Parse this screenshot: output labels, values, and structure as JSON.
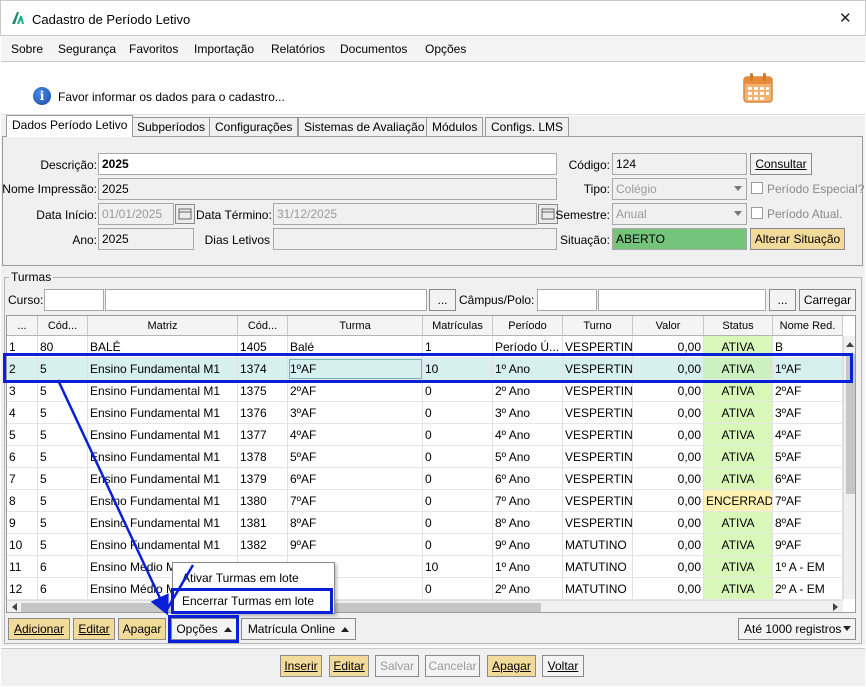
{
  "window": {
    "title": "Cadastro de Período Letivo",
    "close": "✕"
  },
  "menu": [
    "Sobre",
    "Segurança",
    "Favoritos",
    "Importação",
    "Relatórios",
    "Documentos",
    "Opções"
  ],
  "info": {
    "text": "Favor informar os dados para o cadastro..."
  },
  "tabs": [
    "Dados Período Letivo",
    "Subperíodos",
    "Configurações",
    "Sistemas de Avaliação",
    "Módulos",
    "Configs. LMS"
  ],
  "form": {
    "descricao_label": "Descrição:",
    "descricao": "2025",
    "nome_impressao_label": "Nome Impressão:",
    "nome_impressao": "2025",
    "data_inicio_label": "Data Início:",
    "data_inicio": "01/01/2025",
    "data_termino_label": "Data Término:",
    "data_termino": "31/12/2025",
    "ano_label": "Ano:",
    "ano": "2025",
    "dias_letivos_label": "Dias Letivos",
    "codigo_label": "Código:",
    "codigo": "124",
    "consultar": "Consultar",
    "tipo_label": "Tipo:",
    "tipo": "Colégio",
    "periodo_especial": "Período Especial?",
    "semestre_label": "Semestre:",
    "semestre": "Anual",
    "periodo_atual": "Período Atual.",
    "situacao_label": "Situação:",
    "situacao": "ABERTO",
    "alterar_situacao": "Alterar Situação"
  },
  "turmas": {
    "group_label": "Turmas",
    "curso_label": "Curso:",
    "campus_label": "Câmpus/Polo:",
    "dots": "...",
    "carregar": "Carregar",
    "columns": [
      "...",
      "Cód...",
      "Matriz",
      "Cód...",
      "Turma",
      "Matrículas",
      "Período",
      "Turno",
      "Valor",
      "Status",
      "Nome Red."
    ],
    "rows": [
      [
        "1",
        "80",
        "BALÉ",
        "1405",
        "Balé",
        "1",
        "Período Ú...",
        "VESPERTINO",
        "0,00",
        "ATIVA",
        "B"
      ],
      [
        "2",
        "5",
        "Ensino Fundamental M1",
        "1374",
        "1ºAF",
        "10",
        "1º Ano",
        "VESPERTINO",
        "0,00",
        "ATIVA",
        "1ºAF"
      ],
      [
        "3",
        "5",
        "Ensino Fundamental M1",
        "1375",
        "2ºAF",
        "0",
        "2º Ano",
        "VESPERTINO",
        "0,00",
        "ATIVA",
        "2ºAF"
      ],
      [
        "4",
        "5",
        "Ensino Fundamental M1",
        "1376",
        "3ºAF",
        "0",
        "3º Ano",
        "VESPERTINO",
        "0,00",
        "ATIVA",
        "3ºAF"
      ],
      [
        "5",
        "5",
        "Ensino Fundamental M1",
        "1377",
        "4ºAF",
        "0",
        "4º Ano",
        "VESPERTINO",
        "0,00",
        "ATIVA",
        "4ºAF"
      ],
      [
        "6",
        "5",
        "Ensino Fundamental M1",
        "1378",
        "5ºAF",
        "0",
        "5º Ano",
        "VESPERTINO",
        "0,00",
        "ATIVA",
        "5ºAF"
      ],
      [
        "7",
        "5",
        "Ensino Fundamental M1",
        "1379",
        "6ºAF",
        "0",
        "6º Ano",
        "VESPERTINO",
        "0,00",
        "ATIVA",
        "6ºAF"
      ],
      [
        "8",
        "5",
        "Ensino Fundamental M1",
        "1380",
        "7ºAF",
        "0",
        "7º Ano",
        "VESPERTINO",
        "0,00",
        "ENCERRADA",
        "7ºAF"
      ],
      [
        "9",
        "5",
        "Ensino Fundamental M1",
        "1381",
        "8ºAF",
        "0",
        "8º Ano",
        "VESPERTINO",
        "0,00",
        "ATIVA",
        "8ºAF"
      ],
      [
        "10",
        "5",
        "Ensino Fundamental M1",
        "1382",
        "9ºAF",
        "0",
        "9º Ano",
        "MATUTINO",
        "0,00",
        "ATIVA",
        "9ºAF"
      ],
      [
        "11",
        "6",
        "Ensino Médio M1",
        "",
        "",
        "10",
        "1º Ano",
        "MATUTINO",
        "0,00",
        "ATIVA",
        "1º A - EM"
      ],
      [
        "12",
        "6",
        "Ensino Médio M1",
        "",
        "",
        "0",
        "2º Ano",
        "MATUTINO",
        "0,00",
        "ATIVA",
        "2º A - EM"
      ]
    ],
    "selected_row": 1
  },
  "popup": {
    "items": [
      "Ativar Turmas em lote",
      "Encerrar Turmas em lote"
    ]
  },
  "grid_buttons": {
    "adicionar": "Adicionar",
    "editar": "Editar",
    "apagar": "Apagar",
    "opcoes": "Opções",
    "matricula_online": "Matrícula Online",
    "registros": "Até 1000 registros"
  },
  "footer": {
    "inserir": "Inserir",
    "editar": "Editar",
    "salvar": "Salvar",
    "cancelar": "Cancelar",
    "apagar": "Apagar",
    "voltar": "Voltar"
  },
  "colors": {
    "highlight": "#0a1fd8",
    "ativa": "#d9f7b8",
    "encerrada": "#fff2b3",
    "situacao": "#74c47c",
    "yellow_button": "#f2db9a"
  }
}
